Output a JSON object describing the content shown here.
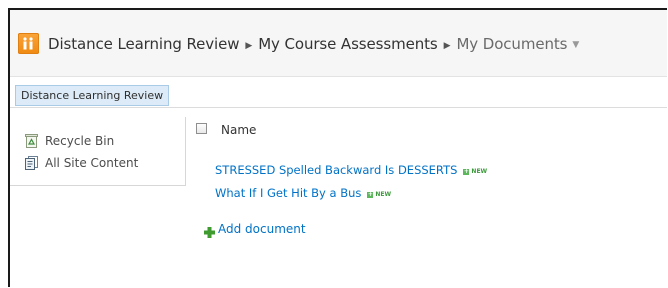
{
  "breadcrumb": {
    "site": "Distance Learning Review",
    "parent": "My Course Assessments",
    "current": "My Documents",
    "separator": "▶",
    "caret": "▼"
  },
  "topnav": {
    "tab_label": "Distance Learning Review"
  },
  "quick_launch": {
    "items": [
      {
        "label": "Recycle Bin",
        "icon": "recycle-bin-icon"
      },
      {
        "label": "All Site Content",
        "icon": "site-content-icon"
      }
    ]
  },
  "list": {
    "column_name": "Name",
    "documents": [
      {
        "title": "STRESSED Spelled Backward Is DESSERTS",
        "badge": "NEW"
      },
      {
        "title": "What If I Get Hit By a Bus",
        "badge": "NEW"
      }
    ],
    "add_document_label": "Add document"
  },
  "colors": {
    "link": "#0072c6",
    "logo": "#f08a10",
    "tab_bg": "#dcebf7",
    "new_badge": "#3b9a3b"
  }
}
